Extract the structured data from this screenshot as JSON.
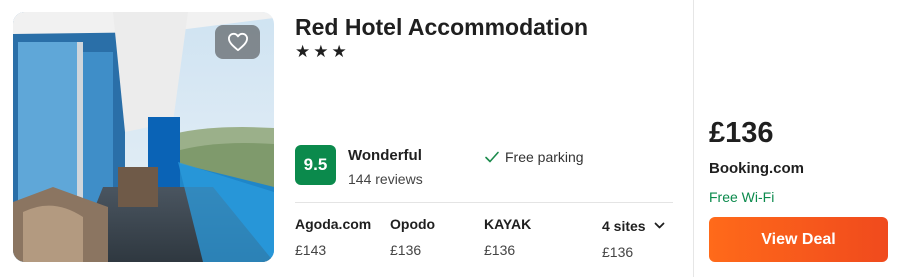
{
  "hotel": {
    "name": "Red Hotel Accommodation",
    "stars_display": "★★★",
    "star_count": 3,
    "favorite_icon": "heart-outline-icon"
  },
  "rating": {
    "score": "9.5",
    "label": "Wonderful",
    "reviews": "144 reviews",
    "badge_color": "#0b8a4c"
  },
  "amenities": {
    "parking": "Free parking",
    "icon": "check-icon"
  },
  "sites": [
    {
      "name": "Agoda.com",
      "price": "£143"
    },
    {
      "name": "Opodo",
      "price": "£136"
    },
    {
      "name": "KAYAK",
      "price": "£136"
    }
  ],
  "more_sites": {
    "label": "4 sites",
    "price": "£136",
    "icon": "chevron-down-icon"
  },
  "deal": {
    "price": "£136",
    "provider": "Booking.com",
    "perk": "Free Wi-Fi",
    "button_label": "View Deal",
    "button_color": "#f45a1c",
    "perk_color": "#0b8a4c"
  }
}
